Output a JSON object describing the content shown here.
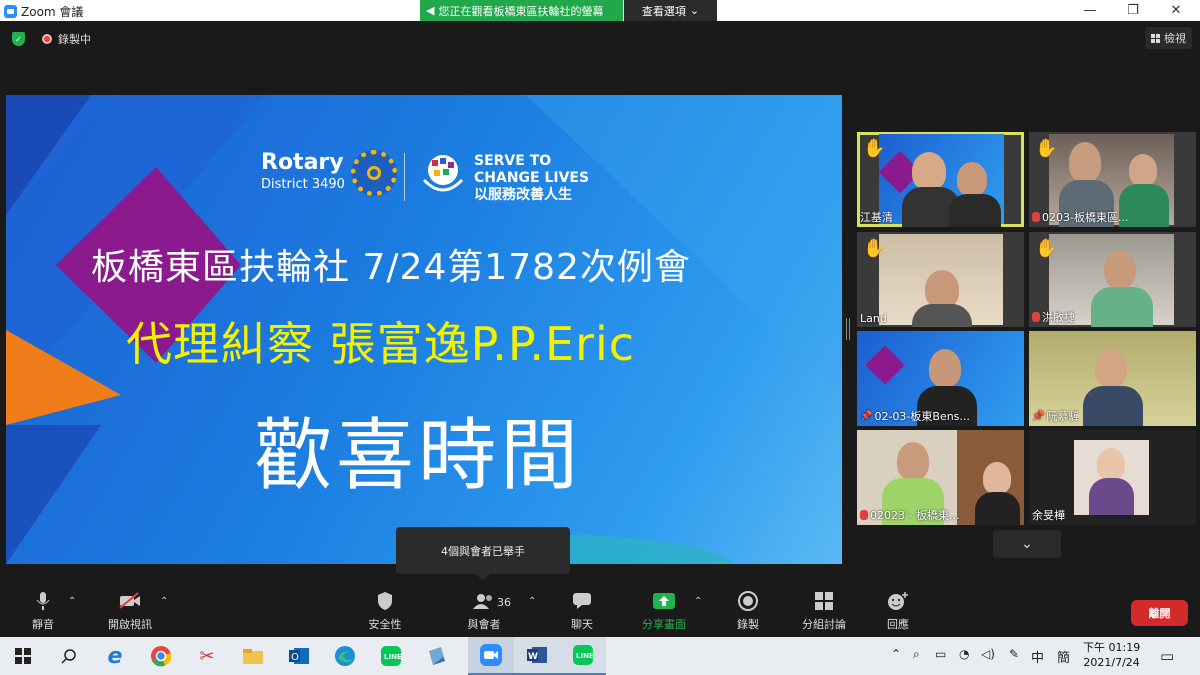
{
  "window": {
    "title": "Zoom 會議",
    "minimize": "—",
    "restore": "❐",
    "close": "✕"
  },
  "share_banner": {
    "text": "您正在觀看板橋東區扶輪社的螢幕",
    "view_options": "查看選項"
  },
  "recording": {
    "label": "錄製中"
  },
  "view_button": {
    "label": "檢視"
  },
  "slide": {
    "rotary_name": "Rotary",
    "district": "District 3490",
    "serve_line1": "SERVE TO",
    "serve_line2": "CHANGE LIVES",
    "serve_line3": "以服務改善人生",
    "title1": "板橋東區扶輪社  7/24第1782次例會",
    "title2": "代理糾察 張富逸P.P.Eric",
    "title3": "歡喜時間"
  },
  "tooltip": {
    "text": "4個與會者已舉手"
  },
  "participants": [
    {
      "name": "江基清",
      "hand": true,
      "muted": false
    },
    {
      "name": "0203-板橋東區...",
      "hand": true,
      "muted": true
    },
    {
      "name": "Land",
      "hand": true,
      "muted": false
    },
    {
      "name": "洪敏捷",
      "hand": true,
      "muted": true
    },
    {
      "name": "02-03-板東Bens...",
      "hand": false,
      "pinned": true
    },
    {
      "name": "阮慕驊",
      "hand": false,
      "pinned": true
    },
    {
      "name": "02023 - 板橋東...",
      "hand": false,
      "muted": true
    },
    {
      "name": "余旻樺",
      "hand": false,
      "muted": false
    }
  ],
  "toolbar": {
    "mute": "靜音",
    "video": "開啟視訊",
    "security": "安全性",
    "participants": "與會者",
    "participants_count": "36",
    "chat": "聊天",
    "share": "分享畫面",
    "record": "錄製",
    "breakout": "分組討論",
    "reactions": "回應",
    "leave": "離開"
  },
  "taskbar": {
    "time": "下午 01:19",
    "date": "2021/7/24",
    "ime": "中",
    "ime2": "簡"
  },
  "colors": {
    "share_green": "#21a84b",
    "leave_red": "#d32b2b",
    "active_border": "#d7e25a",
    "hand_yellow": "#f2b800"
  }
}
